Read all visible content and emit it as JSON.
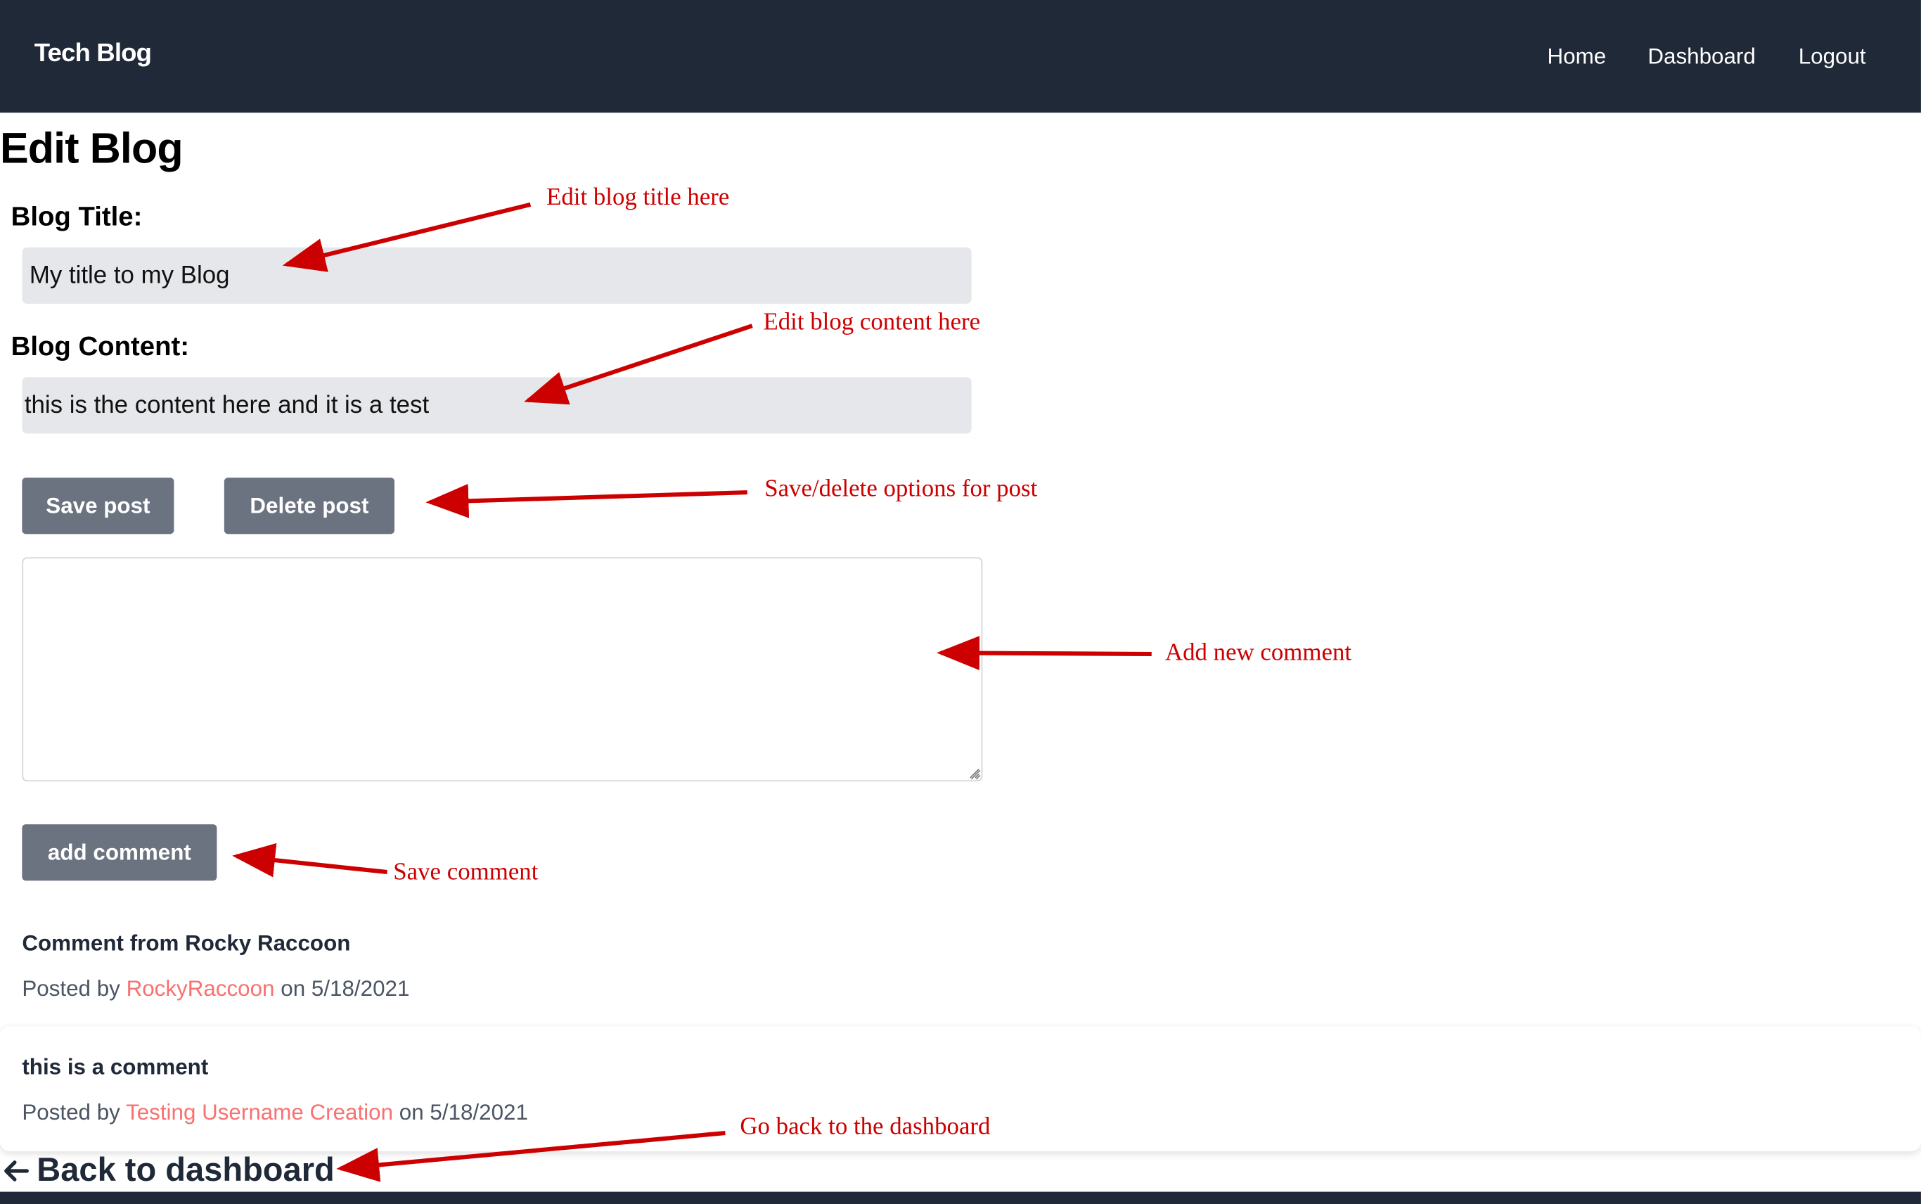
{
  "nav": {
    "brand": "Tech Blog",
    "links": [
      "Home",
      "Dashboard",
      "Logout"
    ]
  },
  "page": {
    "title": "Edit Blog"
  },
  "form": {
    "title_label": "Blog Title:",
    "title_value": "My title to my Blog",
    "content_label": "Blog Content:",
    "content_value": "this is the content here and it is a test",
    "save_label": "Save post",
    "delete_label": "Delete post",
    "comment_value": "",
    "add_comment_label": "add comment"
  },
  "comments": [
    {
      "text": "Comment from Rocky Raccoon",
      "posted_by": "Posted by",
      "author": "RockyRaccoon",
      "on": "on",
      "date": "5/18/2021"
    },
    {
      "text": "this is a comment",
      "posted_by": "Posted by",
      "author": "Testing Username Creation",
      "on": "on",
      "date": "5/18/2021"
    }
  ],
  "back": {
    "icon": "arrow-left-icon",
    "label": "Back to dashboard"
  },
  "annotations": {
    "edit_title": "Edit blog title here",
    "edit_content": "Edit blog content here",
    "save_delete": "Save/delete options for post",
    "add_comment": "Add new comment",
    "save_comment": "Save comment",
    "go_back": "Go back to the dashboard"
  },
  "colors": {
    "nav_bg": "#1f2937",
    "button_bg": "#6b7280",
    "field_bg": "#e5e7eb",
    "author_link": "#f87171",
    "annotation": "#cc0000"
  }
}
